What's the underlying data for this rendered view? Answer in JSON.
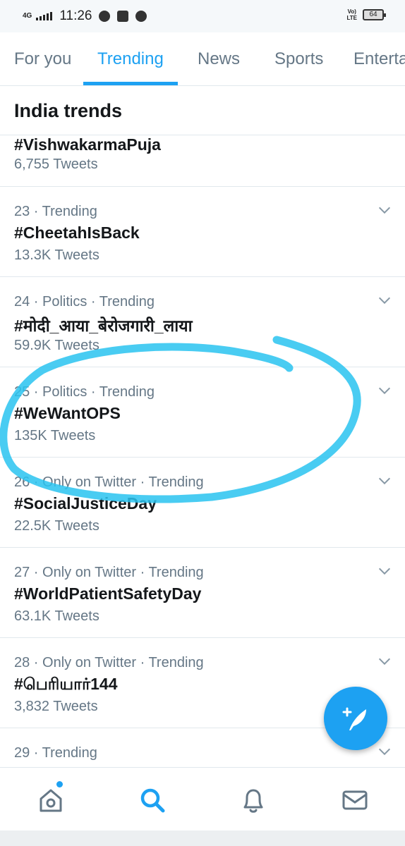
{
  "status_bar": {
    "network": "4G",
    "time": "11:26",
    "volte": "Vo)\nLTE",
    "battery": "64"
  },
  "tabs": [
    {
      "label": "For you",
      "active": false
    },
    {
      "label": "Trending",
      "active": true
    },
    {
      "label": "News",
      "active": false
    },
    {
      "label": "Sports",
      "active": false
    },
    {
      "label": "Enterta",
      "active": false
    }
  ],
  "section": {
    "title": "India trends"
  },
  "trends": [
    {
      "meta": "",
      "name": "#VishwakarmaPuja",
      "count": "6,755 Tweets"
    },
    {
      "meta": "23 · Trending",
      "name": "#CheetahIsBack",
      "count": "13.3K Tweets"
    },
    {
      "meta": "24 · Politics · Trending",
      "name": "#मोदी_आया_बेरोजगारी_लाया",
      "count": "59.9K Tweets"
    },
    {
      "meta": "25 · Politics · Trending",
      "name": "#WeWantOPS",
      "count": "135K Tweets"
    },
    {
      "meta": "26 · Only on Twitter · Trending",
      "name": "#SocialJusticeDay",
      "count": "22.5K Tweets"
    },
    {
      "meta": "27 · Only on Twitter · Trending",
      "name": "#WorldPatientSafetyDay",
      "count": "63.1K Tweets"
    },
    {
      "meta": "28 · Only on Twitter · Trending",
      "name": "#பெரியார்144",
      "count": "3,832 Tweets"
    },
    {
      "meta": "29 · Trending",
      "name": "",
      "count": ""
    }
  ],
  "icons": {
    "chevron": "chevron-down-icon",
    "fab": "compose-tweet-icon",
    "home": "home-icon",
    "search": "search-icon",
    "notifications": "bell-icon",
    "messages": "mail-icon"
  },
  "colors": {
    "accent": "#1da1f2",
    "annotation": "#29c3f0",
    "muted_text": "#657786",
    "divider": "#e1e8ed"
  }
}
